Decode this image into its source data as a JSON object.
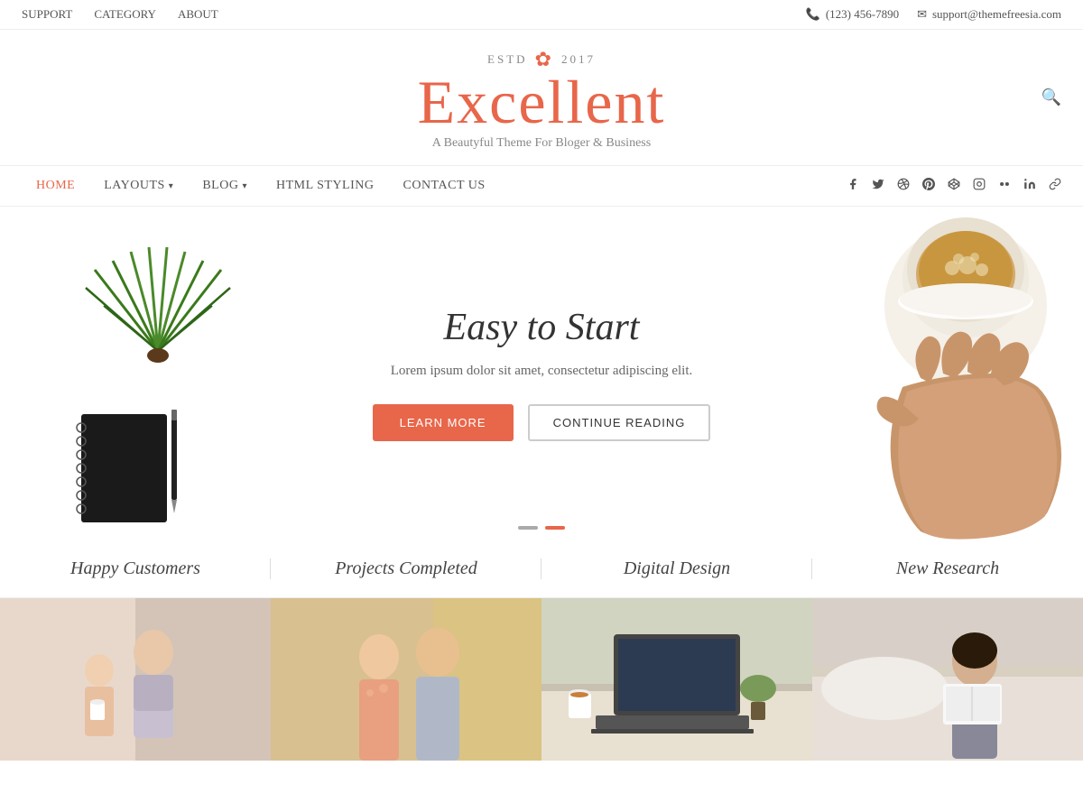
{
  "topbar": {
    "nav": [
      {
        "label": "SUPPORT",
        "href": "#"
      },
      {
        "label": "CATEGORY",
        "href": "#"
      },
      {
        "label": "ABOUT",
        "href": "#"
      }
    ],
    "phone": "(123) 456-7890",
    "email": "support@themefreesia.com"
  },
  "logo": {
    "estd_prefix": "ESTD",
    "estd_year": "2017",
    "name_prefix": "E",
    "name_rest": "xcellent",
    "tagline": "A Beautyful Theme For Bloger & Business"
  },
  "mainnav": {
    "items": [
      {
        "label": "HOME",
        "active": true,
        "hasDropdown": false
      },
      {
        "label": "LAYOUTS",
        "active": false,
        "hasDropdown": true
      },
      {
        "label": "BLOG",
        "active": false,
        "hasDropdown": true
      },
      {
        "label": "HTML STYLING",
        "active": false,
        "hasDropdown": false
      },
      {
        "label": "CONTACT US",
        "active": false,
        "hasDropdown": false
      }
    ],
    "social": [
      "facebook",
      "twitter",
      "dribbble",
      "pinterest",
      "codepen",
      "instagram",
      "flickr",
      "linkedin",
      "link"
    ]
  },
  "hero": {
    "title": "Easy to Start",
    "description": "Lorem ipsum dolor sit amet, consectetur adipiscing elit.",
    "btn_learn": "LEARN MORE",
    "btn_continue": "CONTINUE READING",
    "dots": [
      false,
      true
    ]
  },
  "stats": [
    {
      "label": "Happy Customers"
    },
    {
      "label": "Projects Completed"
    },
    {
      "label": "Digital Design"
    },
    {
      "label": "New Research"
    }
  ],
  "photos": [
    {
      "alt": "mother and child"
    },
    {
      "alt": "couple smiling"
    },
    {
      "alt": "laptop workspace"
    },
    {
      "alt": "person reading"
    }
  ]
}
